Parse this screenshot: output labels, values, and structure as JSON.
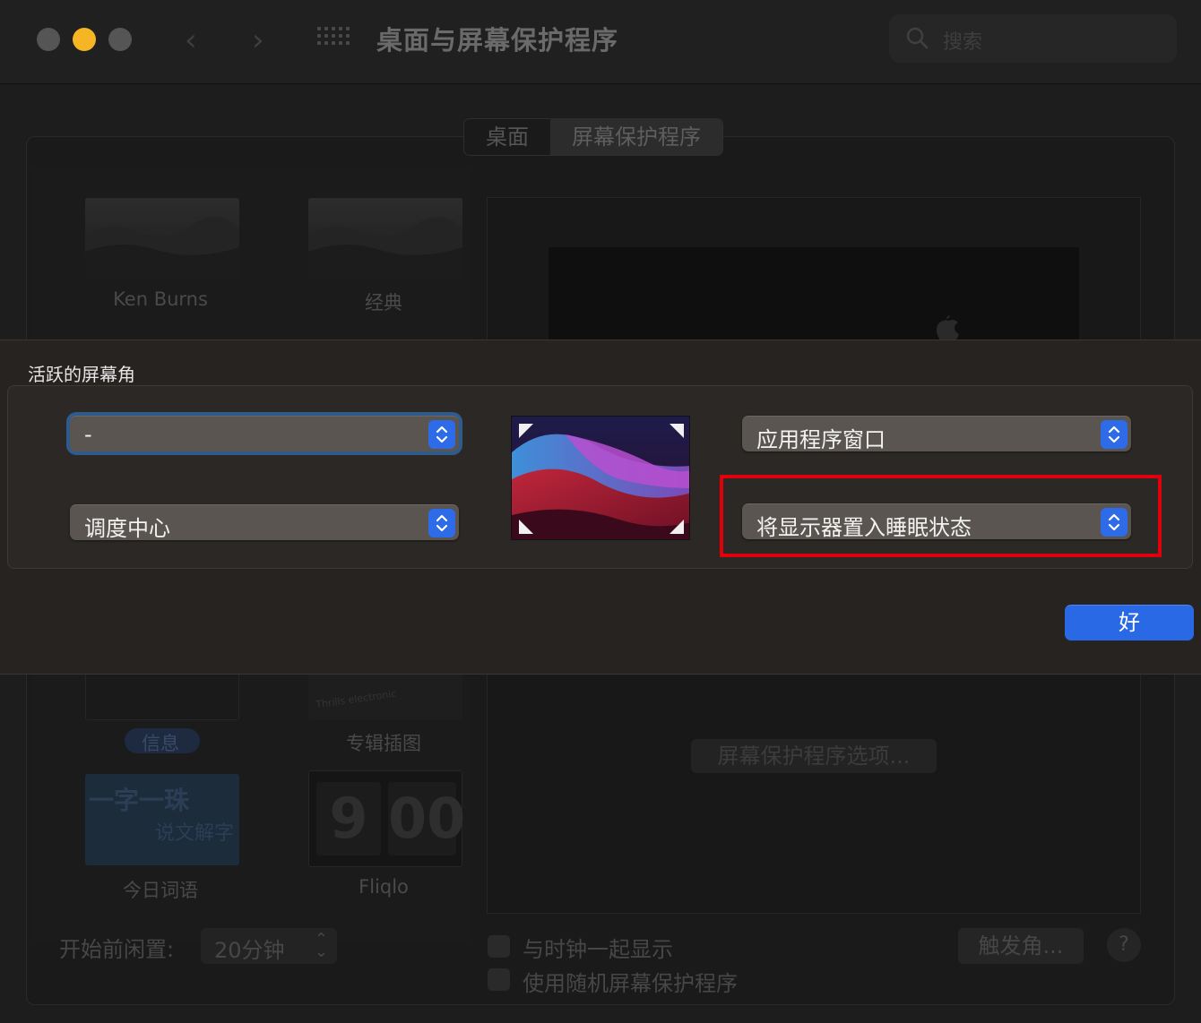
{
  "window": {
    "title": "桌面与屏幕保护程序",
    "search_placeholder": "搜索",
    "tabs": [
      {
        "label": "桌面",
        "active": false
      },
      {
        "label": "屏幕保护程序",
        "active": true
      }
    ]
  },
  "screensavers": [
    {
      "label": "Ken Burns"
    },
    {
      "label": "经典"
    },
    {
      "label": "信息",
      "selected": true
    },
    {
      "label": "专辑插图"
    },
    {
      "label": "今日词语"
    },
    {
      "label": "Fliqlo"
    }
  ],
  "thumb_text": {
    "word_of_day_line1": "一字一珠",
    "word_of_day_line2": "说文解字",
    "fliqlo_hour": "9",
    "fliqlo_minute": "00",
    "album_text": "Thrills electronic"
  },
  "preview": {
    "options_button": "屏幕保护程序选项..."
  },
  "footer": {
    "idle_label": "开始前闲置:",
    "idle_value": "20分钟",
    "show_clock_label": "与时钟一起显示",
    "random_label": "使用随机屏幕保护程序",
    "hot_corners_button": "触发角...",
    "help_button": "?"
  },
  "sheet": {
    "title": "活跃的屏幕角",
    "top_left": "-",
    "bottom_left": "调度中心",
    "top_right": "应用程序窗口",
    "bottom_right": "将显示器置入睡眠状态",
    "ok_button": "好"
  },
  "colors": {
    "accent": "#2a69e5",
    "highlight": "#e0000b",
    "minimize": "#f5b524"
  }
}
